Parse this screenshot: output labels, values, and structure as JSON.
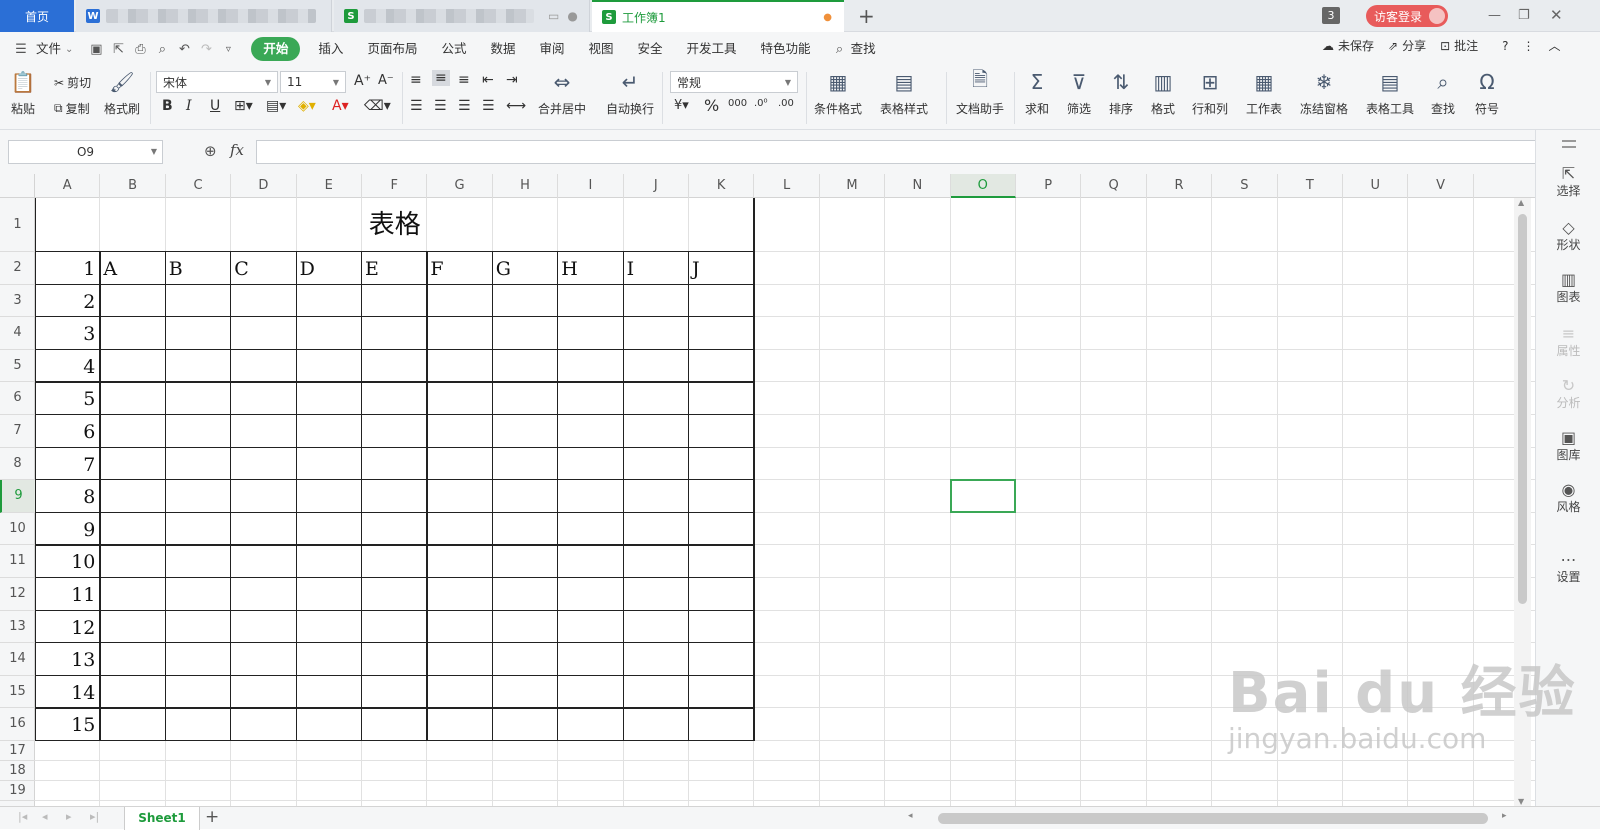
{
  "titlebar": {
    "home_tab": "首页",
    "active_tab": "工作簿1",
    "badge_count": "3",
    "login_button": "访客登录"
  },
  "menubar": {
    "file": "文件",
    "items": [
      "开始",
      "插入",
      "页面布局",
      "公式",
      "数据",
      "审阅",
      "视图",
      "安全",
      "开发工具",
      "特色功能"
    ],
    "search": "查找",
    "unsaved": "未保存",
    "share": "分享",
    "comment": "批注"
  },
  "ribbon": {
    "paste": "粘贴",
    "cut": "剪切",
    "copy": "复制",
    "format_painter": "格式刷",
    "font_name": "宋体",
    "font_size": "11",
    "merge_center": "合并居中",
    "auto_wrap": "自动换行",
    "number_format": "常规",
    "conditional_format": "条件格式",
    "table_style": "表格样式",
    "doc_assistant": "文档助手",
    "sum": "求和",
    "filter": "筛选",
    "sort": "排序",
    "format": "格式",
    "row_col": "行和列",
    "worksheet": "工作表",
    "freeze": "冻结窗格",
    "table_tools": "表格工具",
    "find": "查找",
    "symbol": "符号"
  },
  "formula_bar": {
    "name_box": "O9",
    "fx_label": "fx",
    "content": ""
  },
  "grid": {
    "columns": [
      "A",
      "B",
      "C",
      "D",
      "E",
      "F",
      "G",
      "H",
      "I",
      "J",
      "K",
      "L",
      "M",
      "N",
      "O",
      "P",
      "Q",
      "R",
      "S",
      "T",
      "U",
      "V"
    ],
    "rows": [
      "1",
      "2",
      "3",
      "4",
      "5",
      "6",
      "7",
      "8",
      "9",
      "10",
      "11",
      "12",
      "13",
      "14",
      "15",
      "16",
      "17",
      "18",
      "19"
    ],
    "selected_column": "O",
    "selected_row": "9",
    "table_title": "表格",
    "header_letters": [
      "A",
      "B",
      "C",
      "D",
      "E",
      "F",
      "G",
      "H",
      "I",
      "J"
    ],
    "row_numbers": [
      "1",
      "2",
      "3",
      "4",
      "5",
      "6",
      "7",
      "8",
      "9",
      "10",
      "11",
      "12",
      "13",
      "14",
      "15"
    ]
  },
  "sidebar": {
    "items": [
      {
        "label": "选择",
        "icon": "cursor-icon",
        "enabled": true
      },
      {
        "label": "形状",
        "icon": "shapes-icon",
        "enabled": true
      },
      {
        "label": "图表",
        "icon": "chart-icon",
        "enabled": true
      },
      {
        "label": "属性",
        "icon": "sliders-icon",
        "enabled": false
      },
      {
        "label": "分析",
        "icon": "analysis-icon",
        "enabled": false
      },
      {
        "label": "图库",
        "icon": "image-icon",
        "enabled": true
      },
      {
        "label": "风格",
        "icon": "palette-icon",
        "enabled": true
      },
      {
        "label": "设置",
        "icon": "more-icon",
        "enabled": true
      }
    ]
  },
  "bottom": {
    "sheet_tab": "Sheet1"
  },
  "watermark": {
    "brand": "Bai du 经验",
    "url": "jingyan.baidu.com"
  },
  "colors": {
    "accent_green": "#3aa856",
    "home_blue": "#2b6fd6"
  }
}
